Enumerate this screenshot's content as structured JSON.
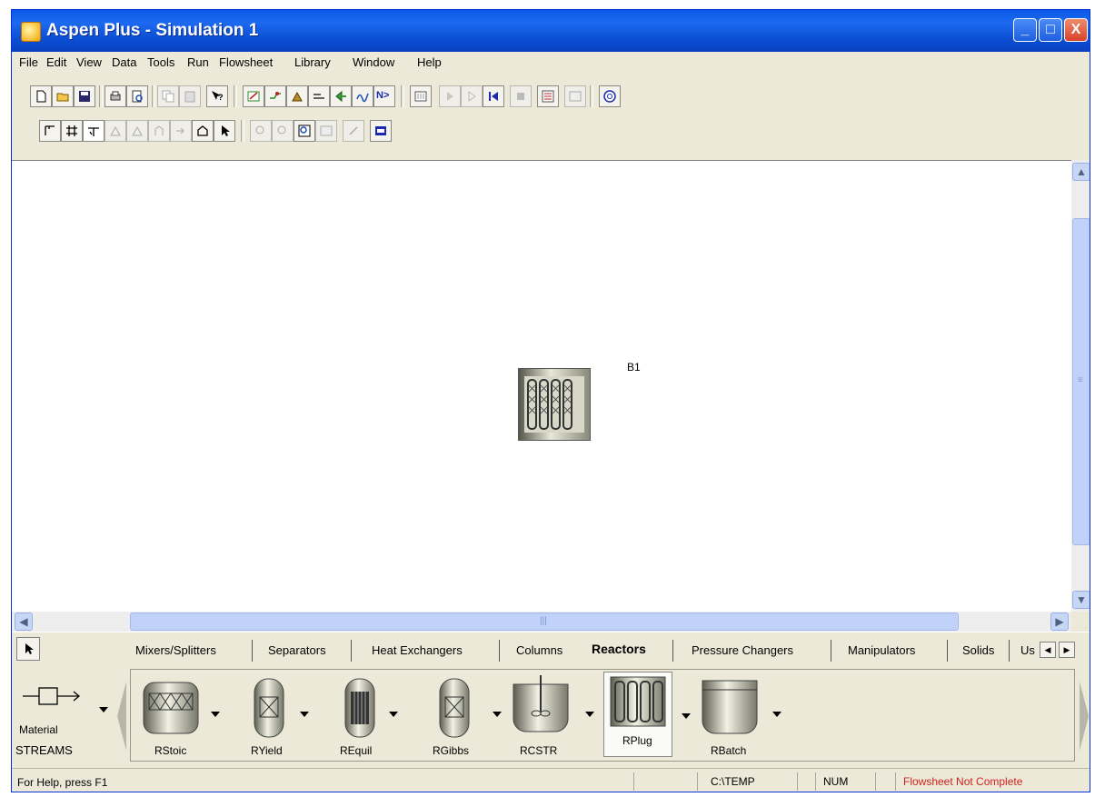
{
  "window": {
    "title": "Aspen Plus - Simulation 1",
    "minimize": "_",
    "maximize": "□",
    "close": "X"
  },
  "menu": [
    "File",
    "Edit",
    "View",
    "Data",
    "Tools",
    "Run",
    "Flowsheet",
    "Library",
    "Window",
    "Help"
  ],
  "toolbar1": {
    "next_button_label": "N>",
    "icons": [
      "new-icon",
      "open-icon",
      "save-icon",
      "print-icon",
      "print-preview-icon",
      "copy-icon",
      "paste-icon",
      "whats-this-help-icon",
      "data-browser-icon",
      "stream-results-icon",
      "flowsheet-icon",
      "stream-icon",
      "model-library-icon",
      "wave-icon",
      "next-icon",
      "control-panel-icon",
      "run-icon",
      "step-icon",
      "reset-icon",
      "stop-icon",
      "results-summary-icon",
      "check-results-icon",
      "calculator-icon"
    ]
  },
  "toolbar2": {
    "icons": [
      "flowsheet-section-icon",
      "grid-icon",
      "align-icon",
      "place-block-icon",
      "place-block-2-icon",
      "place-block-3-icon",
      "export-icon",
      "print-flowsheet-icon",
      "pointer-icon",
      "zoom-in-icon",
      "zoom-out-icon",
      "zoom-full-icon",
      "view-section-icon",
      "annotation-icon",
      "global-data-icon"
    ]
  },
  "flowsheet": {
    "block": {
      "id": "B1",
      "type": "RPlug"
    }
  },
  "palette": {
    "tabs": [
      "Mixers/Splitters",
      "Separators",
      "Heat Exchangers",
      "Columns",
      "Reactors",
      "Pressure Changers",
      "Manipulators",
      "Solids",
      "Us"
    ],
    "active_tab": "Reactors",
    "streams": {
      "top": "Material",
      "bottom": "STREAMS"
    },
    "models": [
      "RStoic",
      "RYield",
      "REquil",
      "RGibbs",
      "RCSTR",
      "RPlug",
      "RBatch"
    ],
    "selected_model": "RPlug"
  },
  "status": {
    "help": "For Help, press F1",
    "path": "C:\\TEMP",
    "num": "NUM",
    "flowsheet_status": "Flowsheet Not Complete",
    "flowsheet_status_color": "#d22020"
  },
  "colors": {
    "title_bar": "#0a58e6",
    "window_bg": "#ece9d8",
    "canvas_bg": "#ffffff",
    "scrollbar_thumb": "#c1d2fa"
  }
}
